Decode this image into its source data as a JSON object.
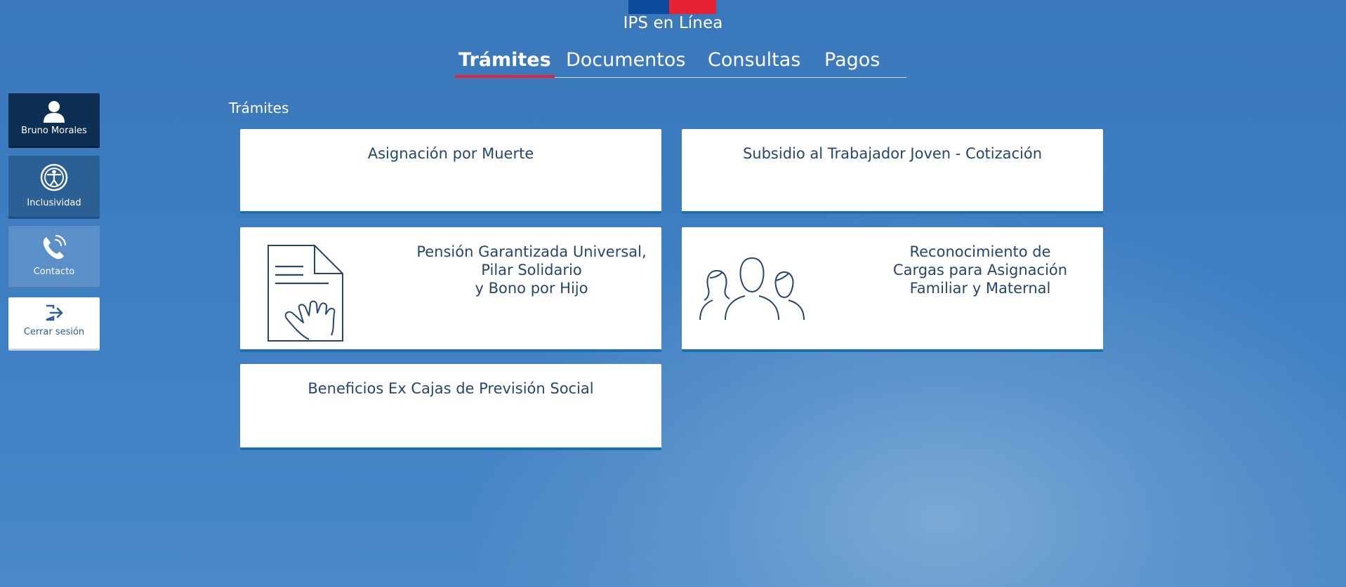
{
  "header": {
    "brand": "IPS en Línea",
    "flag_colors": [
      "#0c4c9c",
      "#e62234"
    ],
    "tabs": [
      {
        "label": "Trámites",
        "active": true
      },
      {
        "label": "Documentos",
        "active": false
      },
      {
        "label": "Consultas",
        "active": false
      },
      {
        "label": "Pagos",
        "active": false
      }
    ]
  },
  "sidebar": {
    "user": {
      "label": "Bruno Morales",
      "icon": "user-icon"
    },
    "inclusividad": {
      "label": "Inclusividad",
      "icon": "accessibility-icon"
    },
    "contacto": {
      "label": "Contacto",
      "icon": "phone-icon"
    },
    "logout": {
      "label": "Cerrar sesión",
      "icon": "logout-icon"
    }
  },
  "main": {
    "section_title": "Trámites",
    "cards": [
      {
        "lines": [
          "Asignación por Muerte"
        ]
      },
      {
        "lines": [
          "Subsidio al Trabajador Joven - Cotización"
        ]
      },
      {
        "lines": [
          "Pensión Garantizada Universal,",
          "Pilar Solidario",
          "y Bono por Hijo"
        ],
        "icon": "document-hand-icon"
      },
      {
        "lines": [
          "Reconocimiento de",
          "Cargas para Asignación",
          "Familiar y Maternal"
        ],
        "icon": "people-group-icon"
      },
      {
        "lines": [
          "Beneficios Ex Cajas de Previsión Social"
        ]
      }
    ]
  },
  "colors": {
    "accent_red": "#e62234",
    "card_text": "#25466f",
    "card_border": "#1d6fae",
    "sidebar_dark": "#0d2f54"
  }
}
